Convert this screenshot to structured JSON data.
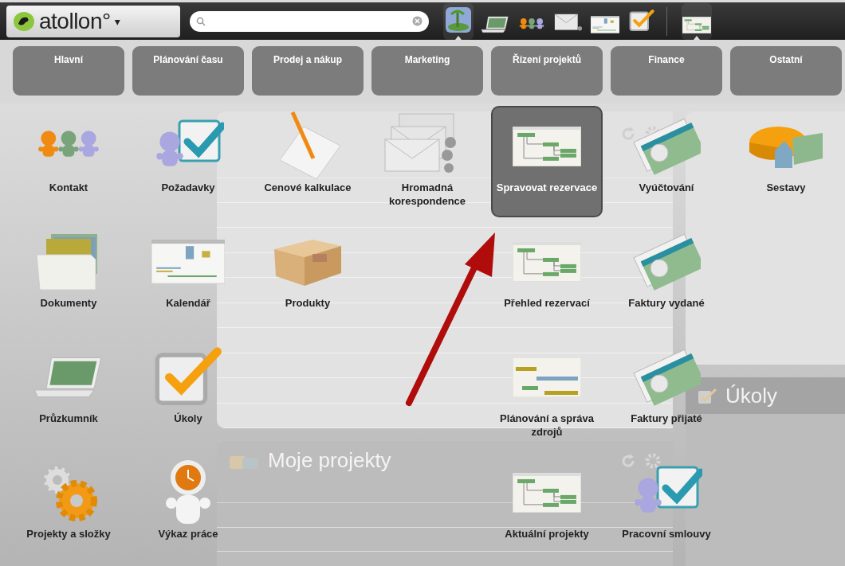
{
  "app": {
    "logo": "atollon°",
    "logo_caret": "▾"
  },
  "toolbar_groups": [
    [
      {
        "kind": "island",
        "selected": true
      },
      {
        "kind": "laptop",
        "selected": false
      },
      {
        "kind": "people",
        "selected": false
      },
      {
        "kind": "mail",
        "selected": false
      },
      {
        "kind": "calendar",
        "selected": false
      },
      {
        "kind": "check",
        "selected": false
      }
    ],
    [
      {
        "kind": "tree",
        "selected": true
      }
    ]
  ],
  "menu": [
    {
      "tab": "Hlavní",
      "items": [
        {
          "label": "Kontakt",
          "kind": "people",
          "selected": false
        },
        {
          "label": "Dokumenty",
          "kind": "folder",
          "selected": false
        },
        {
          "label": "Průzkumník",
          "kind": "laptop",
          "selected": false
        },
        {
          "label": "Projekty a složky",
          "kind": "gears",
          "selected": false
        }
      ]
    },
    {
      "tab": "Plánování času",
      "items": [
        {
          "label": "Požadavky",
          "kind": "person-check",
          "selected": false
        },
        {
          "label": "Kalendář",
          "kind": "calendar",
          "selected": false
        },
        {
          "label": "Úkoly",
          "kind": "check",
          "selected": false
        },
        {
          "label": "Výkaz práce",
          "kind": "clock-person",
          "selected": false
        }
      ]
    },
    {
      "tab": "Prodej a nákup",
      "items": [
        {
          "label": "Cenové kalkulace",
          "kind": "notepad",
          "selected": false
        },
        {
          "label": "Produkty",
          "kind": "box",
          "selected": false
        }
      ]
    },
    {
      "tab": "Marketing",
      "items": [
        {
          "label": "Hromadná korespondence",
          "kind": "envelopes",
          "selected": false
        }
      ]
    },
    {
      "tab": "Řízení projektů",
      "items": [
        {
          "label": "Spravovat rezervace",
          "kind": "tree",
          "selected": true
        },
        {
          "label": "Přehled rezervací",
          "kind": "tree",
          "selected": false
        },
        {
          "label": "Plánování a správa zdrojů",
          "kind": "gantt",
          "selected": false
        },
        {
          "label": "Aktuální projekty",
          "kind": "tree",
          "selected": false
        }
      ]
    },
    {
      "tab": "Finance",
      "items": [
        {
          "label": "Vyúčtování",
          "kind": "money",
          "selected": false
        },
        {
          "label": "Faktury vydané",
          "kind": "money",
          "selected": false
        },
        {
          "label": "Faktury přijaté",
          "kind": "money",
          "selected": false
        },
        {
          "label": "Pracovní smlouvy",
          "kind": "person-check",
          "selected": false
        }
      ]
    },
    {
      "tab": "Ostatní",
      "items": [
        {
          "label": "Sestavy",
          "kind": "pie",
          "selected": false
        }
      ]
    }
  ],
  "dashboard": {
    "my_projects_panel": {
      "title": "Moje projekty"
    },
    "tasks_panel": {
      "title": "Úkoly"
    }
  }
}
